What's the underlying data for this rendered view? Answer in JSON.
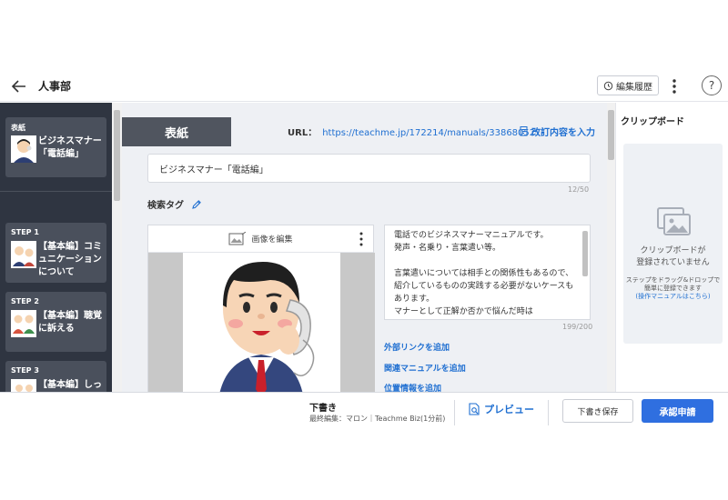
{
  "header": {
    "title": "人事部",
    "history_label": "編集履歴",
    "help_label": "?"
  },
  "sidebar": {
    "cover": {
      "label": "表紙",
      "text": "ビジネスマナー「電話編」"
    },
    "steps": [
      {
        "label": "STEP 1",
        "text": "【基本編】コミュニケーションについて"
      },
      {
        "label": "STEP 2",
        "text": "【基本編】聴覚に訴える"
      },
      {
        "label": "STEP 3",
        "text": "【基本編】しっ"
      }
    ]
  },
  "main": {
    "cover_tab": "表紙",
    "url_label": "URL：",
    "url": "https://teachme.jp/172214/manuals/33868052",
    "revise_label": "改訂内容を入力",
    "title_value": "ビジネスマナー「電話編」",
    "title_counter": "12/50",
    "tag_label": "検索タグ",
    "image_edit_label": "画像を編集",
    "description": "電話でのビジネスマナーマニュアルです。\n発声・名乗り・言葉遣い等。\n\n言葉遣いについては相手との関係性もあるので、紹介しているものの実践する必要がないケースもあります。\nマナーとして正解か否かで悩んだ時は\n「●●の代表としてふさわしいか」を考えましょ",
    "desc_counter": "199/200",
    "links": [
      "外部リンクを追加",
      "関連マニュアルを追加",
      "位置情報を追加"
    ]
  },
  "clipboard": {
    "title": "クリップボード",
    "empty_line1": "クリップボードが",
    "empty_line2": "登録されていません",
    "hint_line1": "ステップをドラッグ&ドロップで",
    "hint_line2": "簡単に登録できます",
    "hint_link": "(操作マニュアルはこちら)"
  },
  "footer": {
    "status": "下書き",
    "editor": "最終編集：マロン｜Teachme Biz(1分前)",
    "preview_label": "プレビュー",
    "save_label": "下書き保存",
    "approve_label": "承認申請"
  },
  "colors": {
    "accent": "#2f6fe0",
    "link": "#1f6fd1",
    "sidebar_bg": "#2f3541",
    "card_bg": "#4a505c",
    "main_bg": "#eef0f4"
  }
}
